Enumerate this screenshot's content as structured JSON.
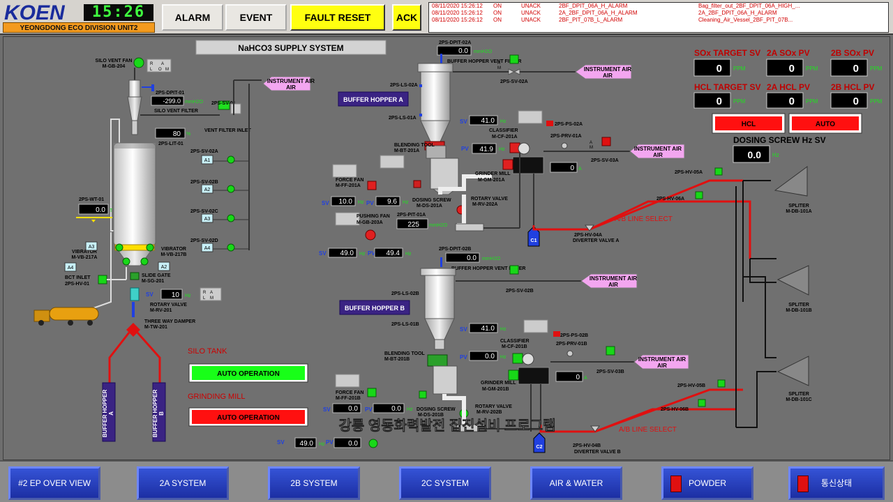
{
  "header": {
    "logo": "KOEN",
    "division": "YEONGDONG ECO DIVISION UNIT2",
    "clock": "15:26",
    "alarm_btn": "ALARM",
    "event_btn": "EVENT",
    "fault_reset_btn": "FAULT RESET",
    "ack_btn": "ACK"
  },
  "alarms": [
    {
      "date": "08/11/2020 15:26:12",
      "state": "ON",
      "ack": "UNACK",
      "tag": "2BF_DPIT_06A_H_ALARM",
      "desc": "Bag_filter_out_2BF_DPIT_06A_HIGH_..."
    },
    {
      "date": "08/11/2020 15:26:12",
      "state": "ON",
      "ack": "UNACK",
      "tag": "2A_2BF_DPIT_06A_H_ALARM",
      "desc": "2A_2BF_DPIT_06A_H_ALARM"
    },
    {
      "date": "08/11/2020 15:26:12",
      "state": "ON",
      "ack": "UNACK",
      "tag": "2BF_PIT_07B_L_ALARM",
      "desc": "Cleaning_Air_Vessel_2BF_PIT_07B..."
    }
  ],
  "title": "NaHCO3 SUPPLY SYSTEM",
  "silo": {
    "vent_fan": "SILO VENT FAN",
    "vent_fan_id": "M-GB-204",
    "dpit": "2PS-DPIT-01",
    "dpit_value": "-299.0",
    "dpit_unit": "mmH2O",
    "vent_filter": "SILO VENT FILTER",
    "sv01": "2PS-SV-01",
    "vent_filter_inlet": "VENT FILTER INLET",
    "level": "80",
    "level_unit": "%",
    "lit": "2PS-LIT-01",
    "wt": "2PS-WT-01",
    "wt_value": "0.0",
    "wt_unit": "T",
    "instrument_air": "INSTRUMENT AIR",
    "sv02a": "2PS-SV-02A",
    "sv02b": "2PS-SV-02B",
    "sv02c": "2PS-SV-02C",
    "sv02d": "2PS-SV-02D",
    "vib_a": "VIBRATOR",
    "vib_a_id": "M-VB-217A",
    "vib_b": "VIBRATOR",
    "vib_b_id": "M-VB-217B",
    "bct_inlet": "BCT INLET",
    "hv01": "2PS-HV-01",
    "slide_gate": "SLIDE GATE",
    "slide_gate_id": "M-SG-201",
    "rv_sv": "10",
    "rv_unit": "Hz",
    "rotary_valve": "ROTARY VALVE",
    "rotary_valve_id": "M-RV-201",
    "damper": "THREE WAY DAMPER",
    "damper_id": "M-TW-201",
    "hopper_a": "BUFFER HOPPER",
    "hopper_a_letter": "A",
    "hopper_b": "BUFFER HOPPER",
    "hopper_b_letter": "B"
  },
  "status": {
    "silo_tank": "SILO TANK",
    "silo_state": "AUTO OPERATION",
    "grinding_mill": "GRINDING MILL",
    "grinding_state": "AUTO OPERATION"
  },
  "line_a": {
    "dpit": "2PS-DPIT-02A",
    "dpit_value": "0.0",
    "dpit_unit": "mmH2O",
    "vent_filter": "BUFFER HOPPER VENT FILTER",
    "sv02": "2PS-SV-02A",
    "instrument_air": "INSTRUMENT AIR",
    "hopper": "BUFFER HOPPER A",
    "ls02": "2PS-LS-02A",
    "ls01": "2PS-LS-01A",
    "blending": "BLENDING TOOL",
    "blending_id": "M-BT-201A",
    "force_fan": "FORCE FAN",
    "force_fan_id": "M-FF-201A",
    "ff_sv": "10.0",
    "ff_pv": "9.6",
    "ds": "DOSING SCREW",
    "ds_id": "M-DS-201A",
    "pit": "2PS-PIT-01A",
    "pit_value": "225",
    "pit_unit": "mmH2O",
    "pushing_fan": "PUSHING FAN",
    "pushing_fan_id": "M-GB-203A",
    "ds_sv": "49.0",
    "ds_pv": "49.4",
    "cf_sv": "41.0",
    "cf_pv": "41.9",
    "classifier": "CLASSIFIER",
    "classifier_id": "M-CF-201A",
    "grinder": "GRINDER MILL",
    "grinder_id": "M-GM-201A",
    "rotary": "ROTARY VALVE",
    "rotary_id": "M-RV-202A",
    "ps": "2PS-PS-02A",
    "prv": "2PS-PRV-01A",
    "current": "0",
    "current_unit": "A",
    "sv03": "2PS-SV-03A",
    "air2": "INSTRUMENT AIR",
    "c": "C1",
    "div": "DIVERTER VALVE A",
    "div_id": "2PS-HV-04A",
    "hv05": "2PS-HV-05A",
    "hv06": "2PS-HV-06A",
    "ab": "A/B LINE SELECT"
  },
  "line_b": {
    "dpit": "2PS-DPIT-02B",
    "dpit_value": "0.0",
    "dpit_unit": "mmH2O",
    "vent_filter": "BUFFER HOPPER VENT FILTER",
    "sv02": "2PS-SV-02B",
    "instrument_air": "INSTRUMENT AIR",
    "hopper": "BUFFER HOPPER B",
    "ls02": "2PS-LS-02B",
    "ls01": "2PS-LS-01B",
    "blending": "BLENDING TOOL",
    "blending_id": "M-BT-201B",
    "force_fan": "FORCE FAN",
    "force_fan_id": "M-FF-201B",
    "ff_sv": "0.0",
    "ff_pv": "0.0",
    "ds": "DOSING SCREW",
    "ds_id": "M-DS-201B",
    "ds_sv": "49.0",
    "ds_pv": "0.0",
    "cf_sv": "41.0",
    "cf_pv": "0.0",
    "classifier": "CLASSIFIER",
    "classifier_id": "M-CF-201B",
    "grinder": "GRINDER MILL",
    "grinder_id": "M-GM-201B",
    "rotary": "ROTARY VALVE",
    "rotary_id": "M-RV-202B",
    "ps": "2PS-PS-02B",
    "prv": "2PS-PRV-01B",
    "current": "0",
    "current_unit": "A",
    "sv03": "2PS-SV-03B",
    "air2": "INSTRUMENT AIR",
    "c": "C2",
    "div": "DIVERTER VALVE B",
    "div_id": "2PS-HV-04B",
    "hv05": "2PS-HV-05B",
    "hv06": "2PS-HV-06B",
    "ab": "A/B LINE SELECT"
  },
  "targets": {
    "sox_target": "SOx TARGET SV",
    "sox_target_v": "0",
    "sox_a": "2A SOx PV",
    "sox_a_v": "0",
    "sox_b": "2B SOx PV",
    "sox_b_v": "0",
    "hcl_target": "HCL TARGET SV",
    "hcl_target_v": "0",
    "hcl_a": "2A HCL PV",
    "hcl_a_v": "0",
    "hcl_b": "2B HCL PV",
    "hcl_b_v": "0",
    "ppm": "PPM",
    "hcl_btn": "HCL",
    "auto_btn": "AUTO",
    "dosing_title": "DOSING SCREW Hz SV",
    "dosing_v": "0.0",
    "dosing_unit": "Hz"
  },
  "splitters": [
    {
      "name": "SPLITER",
      "id": "M-DB-101A"
    },
    {
      "name": "SPLITER",
      "id": "M-DB-101B"
    },
    {
      "name": "SPLITER",
      "id": "M-DB-101C"
    }
  ],
  "labels": {
    "sv": "SV",
    "pv": "PV",
    "hz": "Hz",
    "r": "R",
    "a": "A",
    "l": "L",
    "m": "M",
    "o": "O",
    "a1": "A1",
    "a2": "A2",
    "a3": "A3",
    "a4": "A4"
  },
  "watermark": "강릉 영동화력발전 집진설비 프로그램",
  "nav": [
    "#2 EP OVER VIEW",
    "2A SYSTEM",
    "2B SYSTEM",
    "2C SYSTEM",
    "AIR & WATER",
    "POWDER",
    "통신상태"
  ],
  "colors": {
    "panel": "#707070",
    "alarm_text": "#d10000",
    "run": "#16e016",
    "stop": "#e01010",
    "air_tag": "#f3a6f0",
    "hopper_tag": "#3a2383",
    "pipe_red": "#e01010",
    "nav_blue": "#2238b8"
  }
}
